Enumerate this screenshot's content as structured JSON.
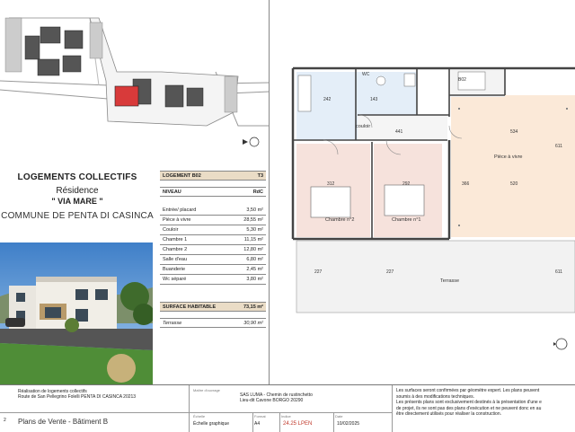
{
  "title_block": {
    "line1": "LOGEMENTS COLLECTIFS",
    "line2": "Résidence",
    "line3": "\" VIA MARE \"",
    "line4": "COMMUNE DE PENTA DI CASINCA"
  },
  "surfaces": {
    "logement_label": "LOGEMENT B02",
    "logement_type": "T3",
    "niveau_label": "NIVEAU",
    "niveau_value": "RdC",
    "rows": [
      {
        "label": "Entrée/ placard",
        "value": "3,50 m²"
      },
      {
        "label": "Pièce à vivre",
        "value": "28,55 m²"
      },
      {
        "label": "Couloir",
        "value": "5,30 m²"
      },
      {
        "label": "Chambre 1",
        "value": "11,15 m²"
      },
      {
        "label": "Chambre 2",
        "value": "12,80 m²"
      },
      {
        "label": "Salle d'eau",
        "value": "6,80 m²"
      },
      {
        "label": "Buanderie",
        "value": "2,45 m²"
      },
      {
        "label": "Wc séparé",
        "value": "3,80 m²"
      }
    ],
    "habitable_label": "SURFACE HABITABLE",
    "habitable_value": "73,15 m²",
    "terrasse_label": "Terrasse",
    "terrasse_value": "30,90 m²"
  },
  "plan": {
    "rooms": {
      "wc": "WC",
      "couloir": "couloir",
      "piece_a_vivre": "Pièce à vivre",
      "chambre2": "Chambre n°2",
      "chambre1": "Chambre n°1",
      "terrasse": "Terrasse",
      "b02": "B02"
    },
    "dims": [
      "242",
      "143",
      "441",
      "534",
      "520",
      "312",
      "292",
      "366",
      "227",
      "227",
      "611",
      "611"
    ]
  },
  "cartouche": {
    "project_lines": [
      "Réalisation de logements collectifs",
      "Route de San Pellegrino Folelli PENTA DI CASINCA 20213"
    ],
    "maitre_label": "Maître d'ouvrage",
    "maitre_lines": [
      "SAS LUMA - Chemin de rustinchetto",
      "Lieu-dit Cavone BORGO 20290"
    ],
    "plan_number": "2",
    "plan_title": "Plans de Vente - Bâtiment B",
    "echelle_label": "Échelle",
    "echelle_value": "Échelle graphique",
    "format_label": "Format",
    "format_value": "A4",
    "indice_label": "Indice",
    "indice_value": "24.25 LPEN",
    "date_label": "Date",
    "date_value": "10/02/2025",
    "notes": [
      "Les surfaces seront confirmées par géomètre expert. Les plans peuvent",
      "soumis à des modifications techniques.",
      "Les présents plans sont exclusivement destinés à la présentation d'une e",
      "de projet, ils ne sont pas des plans d'exécution et ne peuvent donc en au",
      "être directement utilisés pour réaliser la construction."
    ]
  },
  "colors": {
    "highlight": "#d83a3a",
    "header_fill": "#eadcc6",
    "room_pink": "#f6e2dc",
    "room_peach": "#fbe9d8",
    "room_blue": "#e4eef8"
  }
}
